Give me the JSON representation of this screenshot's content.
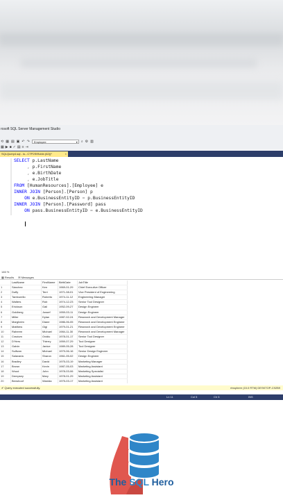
{
  "window": {
    "title": "rosoft SQL Server Management Studio"
  },
  "toolbar": {
    "database": "Employee"
  },
  "doc_tab": {
    "label": "SQLQuery4.sql - lo...CTP2S\\Robin (62))*",
    "close": "×"
  },
  "editor": {
    "lines": [
      "SELECT p.LastName",
      "     , p.FirstName",
      "     , e.BirthDate",
      "     , e.JobTitle",
      "FROM [HumanResources].[Employee] e",
      "INNER JOIN [Person].[Person] p",
      "    ON e.BusinessEntityID = p.BusinessEntityID",
      "INNER JOIN [Person].[Password] pass",
      "    ON pass.BusinessEntityID = e.BusinessEntityID"
    ]
  },
  "zoom": "146 %",
  "results_tabs": {
    "results": "Results",
    "messages": "Messages"
  },
  "grid": {
    "columns": [
      "",
      "LastName",
      "FirstName",
      "BirthDate",
      "JobTitle"
    ],
    "rows": [
      [
        "1",
        "Sánchez",
        "Ken",
        "1969-01-29",
        "Chief Executive Officer"
      ],
      [
        "2",
        "Duffy",
        "Terri",
        "1971-08-01",
        "Vice President of Engineering"
      ],
      [
        "3",
        "Tamburello",
        "Roberto",
        "1974-11-12",
        "Engineering Manager"
      ],
      [
        "4",
        "Walters",
        "Rob",
        "1974-12-23",
        "Senior Tool Designer"
      ],
      [
        "5",
        "Erickson",
        "Gail",
        "1952-09-27",
        "Design Engineer"
      ],
      [
        "6",
        "Goldberg",
        "Jossef",
        "1959-03-11",
        "Design Engineer"
      ],
      [
        "7",
        "Miller",
        "Dylan",
        "1987-02-24",
        "Research and Development Manager"
      ],
      [
        "8",
        "Margheim",
        "Diane",
        "1986-06-05",
        "Research and Development Engineer"
      ],
      [
        "9",
        "Matthew",
        "Gigi",
        "1979-01-21",
        "Research and Development Engineer"
      ],
      [
        "10",
        "Raheem",
        "Michael",
        "1984-11-30",
        "Research and Development Manager"
      ],
      [
        "11",
        "Cracium",
        "Ovidiu",
        "1978-01-17",
        "Senior Tool Designer"
      ],
      [
        "12",
        "D'Hers",
        "Thierry",
        "1959-07-29",
        "Tool Designer"
      ],
      [
        "13",
        "Galvin",
        "Janice",
        "1989-05-28",
        "Tool Designer"
      ],
      [
        "14",
        "Sullivan",
        "Michael",
        "1979-06-16",
        "Senior Design Engineer"
      ],
      [
        "15",
        "Salavaria",
        "Sharon",
        "1961-05-02",
        "Design Engineer"
      ],
      [
        "16",
        "Bradley",
        "David",
        "1975-03-19",
        "Marketing Manager"
      ],
      [
        "17",
        "Brown",
        "Kevin",
        "1987-05-03",
        "Marketing Assistant"
      ],
      [
        "18",
        "Wood",
        "John",
        "1978-03-06",
        "Marketing Specialist"
      ],
      [
        "19",
        "Dempsey",
        "Mary",
        "1978-01-29",
        "Marketing Assistant"
      ],
      [
        "20",
        "Benshoof",
        "Wanida",
        "1975-03-17",
        "Marketing Assistant"
      ],
      [
        "21",
        "Eminhizer",
        "Terry",
        "1986-02-04",
        "Marketing Specialist"
      ],
      [
        "22",
        "Harnpadoungsataya",
        "Sariya",
        "1987-06-21",
        "Marketing Specialist"
      ]
    ]
  },
  "results_status": {
    "message": "Query executed successfully.",
    "server": "rtnsphere (15.0 RTM)   DESKTOP-C92B9"
  },
  "statusbar": {
    "ln": "Ln 11",
    "col": "Col 5",
    "ch": "Ch 5",
    "mode": "INS"
  },
  "brand": {
    "part1": "The ",
    "part2": "SQL",
    "part3": " Hero"
  },
  "colors": {
    "status_bar": "#2d3e6a",
    "tab_active": "#ffe98a",
    "keyword": "#0000ff",
    "brand": "#1f5e9e",
    "logo_red": "#e0574f",
    "logo_blue": "#2f86c8"
  }
}
